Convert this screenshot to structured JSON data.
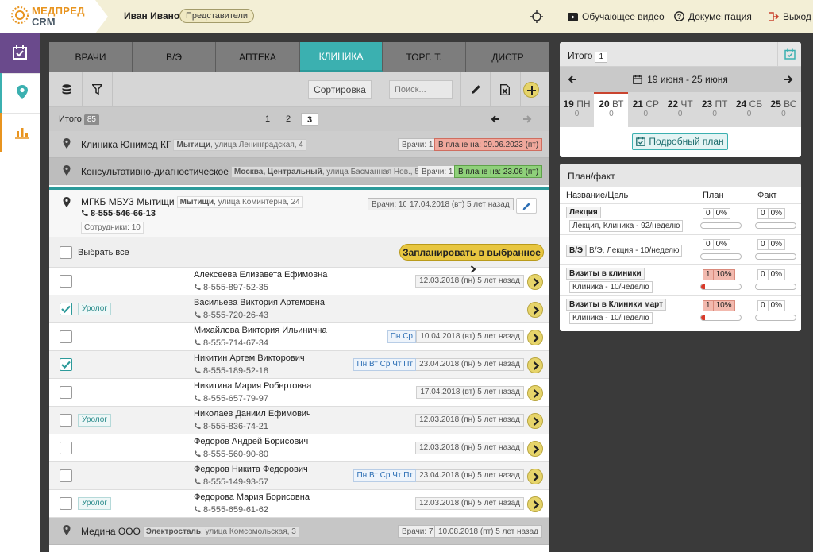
{
  "app": {
    "logo_top": "МЕДПРЕД",
    "logo_bottom": "CRM",
    "brand_color": "#e8941f",
    "accent_color": "#3bb0b0"
  },
  "header": {
    "user_name": "Иван Иванов",
    "role": "Представители",
    "training_video": "Обучающее видео",
    "documentation": "Документация",
    "logout": "Выход"
  },
  "sidebar": {
    "items": [
      {
        "name": "calendar-icon",
        "active": true
      },
      {
        "name": "map-pin-icon",
        "active": false
      },
      {
        "name": "bar-chart-icon",
        "active": false
      }
    ]
  },
  "tabs": [
    {
      "label": "ВРАЧИ"
    },
    {
      "label": "В/Э"
    },
    {
      "label": "АПТЕКА"
    },
    {
      "label": "КЛИНИКА",
      "active": true
    },
    {
      "label": "ТОРГ. Т."
    },
    {
      "label": "ДИСТР"
    }
  ],
  "toolbar": {
    "sort_label": "Сортировка",
    "search_placeholder": "Поиск..."
  },
  "pager": {
    "total_label": "Итого",
    "total_count": "85",
    "pages": [
      "1",
      "2",
      "3"
    ],
    "current_page": "3"
  },
  "clinics": [
    {
      "name": "Клиника Юнимед КГ",
      "city": "Мытищи",
      "street": ", улица Ленинградская, 4",
      "doctors": "Врачи: 1",
      "plan": "В плане на: 09.06.2023 (пт)",
      "plan_status": "red"
    },
    {
      "name": "Консультативно-диагностическое",
      "city": "Москва, Центральный",
      "street": ", улица Басманная Нов., 5",
      "doctors": "Врачи: 1",
      "plan": "В плане на: 23.06 (пт)",
      "plan_status": "green"
    }
  ],
  "expanded_clinic": {
    "name": "МГКБ МБУЗ Мытищи",
    "city": "Мытищи",
    "street": ", улица Коминтерна, 24",
    "phone": "8-555-546-66-13",
    "staff": "Сотрудники: 10",
    "doctors": "Врачи: 10",
    "last_visit": "17.04.2018 (вт) 5 лет назад"
  },
  "select_all_label": "Выбрать все",
  "plan_selected_label": "Запланировать в выбранное",
  "doctors": [
    {
      "name": "Алексеева Елизавета Ефимовна",
      "phone": "8-555-897-52-35",
      "specialty": "",
      "days": "",
      "last_visit": "12.03.2018 (пн) 5 лет назад",
      "checked": false
    },
    {
      "name": "Васильева Виктория Артемовна",
      "phone": "8-555-720-26-43",
      "specialty": "Уролог",
      "days": "",
      "last_visit": "",
      "checked": true
    },
    {
      "name": "Михайлова Виктория Ильинична",
      "phone": "8-555-714-67-34",
      "specialty": "",
      "days": "Пн Ср",
      "last_visit": "10.04.2018 (вт) 5 лет назад",
      "checked": false
    },
    {
      "name": "Никитин Артем Викторович",
      "phone": "8-555-189-52-18",
      "specialty": "",
      "days": "Пн Вт Ср Чт Пт",
      "last_visit": "23.04.2018 (пн) 5 лет назад",
      "checked": true
    },
    {
      "name": "Никитина Мария Робертовна",
      "phone": "8-555-657-79-97",
      "specialty": "",
      "days": "",
      "last_visit": "17.04.2018 (вт) 5 лет назад",
      "checked": false
    },
    {
      "name": "Николаев Даниил Ефимович",
      "phone": "8-555-836-74-21",
      "specialty": "Уролог",
      "days": "",
      "last_visit": "12.03.2018 (пн) 5 лет назад",
      "checked": false
    },
    {
      "name": "Федоров Андрей Борисович",
      "phone": "8-555-560-90-80",
      "specialty": "",
      "days": "",
      "last_visit": "12.03.2018 (пн) 5 лет назад",
      "checked": false
    },
    {
      "name": "Федоров Никита Федорович",
      "phone": "8-555-149-93-57",
      "specialty": "",
      "days": "Пн Вт Ср Чт Пт",
      "last_visit": "23.04.2018 (пн) 5 лет назад",
      "checked": false
    },
    {
      "name": "Федорова Мария Борисовна",
      "phone": "8-555-659-61-62",
      "specialty": "Уролог",
      "days": "",
      "last_visit": "12.03.2018 (пн) 5 лет назад",
      "checked": false
    }
  ],
  "last_clinic": {
    "name": "Медина ООО",
    "city": "Электросталь",
    "street": ", улица Комсомольская, 3",
    "doctors": "Врачи: 7",
    "last_visit": "10.08.2018 (пт) 5 лет назад"
  },
  "week": {
    "total_label": "Итого",
    "total_count": "1",
    "range": "19 июня - 25 июня",
    "days": [
      {
        "num": "19",
        "dow": "ПН",
        "count": "0"
      },
      {
        "num": "20",
        "dow": "ВТ",
        "count": "0",
        "active": true
      },
      {
        "num": "21",
        "dow": "СР",
        "count": "0"
      },
      {
        "num": "22",
        "dow": "ЧТ",
        "count": "0"
      },
      {
        "num": "23",
        "dow": "ПТ",
        "count": "0"
      },
      {
        "num": "24",
        "dow": "СБ",
        "count": "0"
      },
      {
        "num": "25",
        "dow": "ВС",
        "count": "0"
      }
    ],
    "detail_plan": "Подробный план"
  },
  "planfact": {
    "title": "План/факт",
    "col_name": "Название/Цель",
    "col_plan": "План",
    "col_fact": "Факт",
    "rows": [
      {
        "title": "Лекция",
        "target": "Лекция, Клиника - 92/неделю",
        "plan_n": "0",
        "plan_pct": "0%",
        "plan_fill": 0,
        "fact_n": "0",
        "fact_pct": "0%",
        "fact_fill": 0
      },
      {
        "title": "В/Э",
        "target": "В/Э, Лекция - 10/неделю",
        "plan_n": "0",
        "plan_pct": "0%",
        "plan_fill": 0,
        "fact_n": "0",
        "fact_pct": "0%",
        "fact_fill": 0
      },
      {
        "title": "Визиты в клиники",
        "target": "Клиника - 10/неделю",
        "plan_n": "1",
        "plan_pct": "10%",
        "plan_fill": 0.1,
        "fact_n": "0",
        "fact_pct": "0%",
        "fact_fill": 0
      },
      {
        "title": "Визиты в Клиники март",
        "target": "Клиника - 10/неделю",
        "plan_n": "1",
        "plan_pct": "10%",
        "plan_fill": 0.1,
        "fact_n": "0",
        "fact_pct": "0%",
        "fact_fill": 0
      }
    ]
  }
}
